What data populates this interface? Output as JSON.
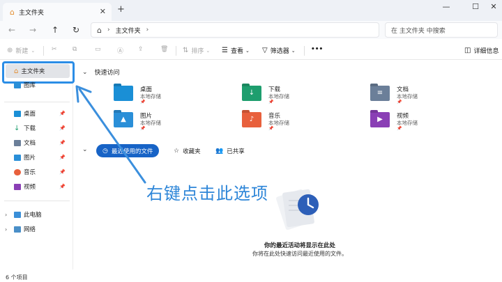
{
  "tab": {
    "title": "主文件夹",
    "close": "✕",
    "new": "+"
  },
  "window": {
    "minimize": "—",
    "maximize": "☐",
    "close": "✕"
  },
  "nav": {
    "back": "←",
    "forward": "→",
    "up": "↑",
    "refresh": "↻"
  },
  "address": {
    "home_glyph": "⌂",
    "path": "主文件夹",
    "sep": "›"
  },
  "search": {
    "placeholder": "在 主文件夹 中搜索"
  },
  "commands": {
    "new": "新建",
    "sort": "排序",
    "view": "查看",
    "filter": "筛选器",
    "more": "•••",
    "details": "详细信息"
  },
  "sidebar": {
    "home": "主文件夹",
    "gallery": "图库",
    "pinned": [
      {
        "label": "桌面",
        "color": "#1a8fd6"
      },
      {
        "label": "下载",
        "color": "#1e9e6e"
      },
      {
        "label": "文档",
        "color": "#6b7f99"
      },
      {
        "label": "图片",
        "color": "#2a8fd8"
      },
      {
        "label": "音乐",
        "color": "#e8603c"
      },
      {
        "label": "视频",
        "color": "#8a3fb5"
      }
    ],
    "this_pc": "此电脑",
    "network": "网络"
  },
  "quick_access": {
    "title": "快速访问",
    "items": [
      {
        "name": "桌面",
        "sub": "本地存储",
        "color": "#1a8fd6",
        "glyph": ""
      },
      {
        "name": "下载",
        "sub": "本地存储",
        "color": "#1e9e6e",
        "glyph": "↓"
      },
      {
        "name": "文档",
        "sub": "本地存储",
        "color": "#6b7f99",
        "glyph": "≡"
      },
      {
        "name": "图片",
        "sub": "本地存储",
        "color": "#2a8fd8",
        "glyph": "▲"
      },
      {
        "name": "音乐",
        "sub": "本地存储",
        "color": "#e8603c",
        "glyph": "♪"
      },
      {
        "name": "视频",
        "sub": "本地存储",
        "color": "#8a3fb5",
        "glyph": "▶"
      }
    ]
  },
  "recent_tabs": {
    "recent": "最近使用的文件",
    "favorites": "收藏夹",
    "shared": "已共享"
  },
  "empty_state": {
    "title": "你的最近活动将显示在此处",
    "subtitle": "你将在此处快速访问最近使用的文件。"
  },
  "status": {
    "count": "6 个项目"
  },
  "annotation": {
    "text": "右键点击此选项"
  },
  "colors": {
    "accent": "#1763c6",
    "highlight": "#2b8de6"
  }
}
